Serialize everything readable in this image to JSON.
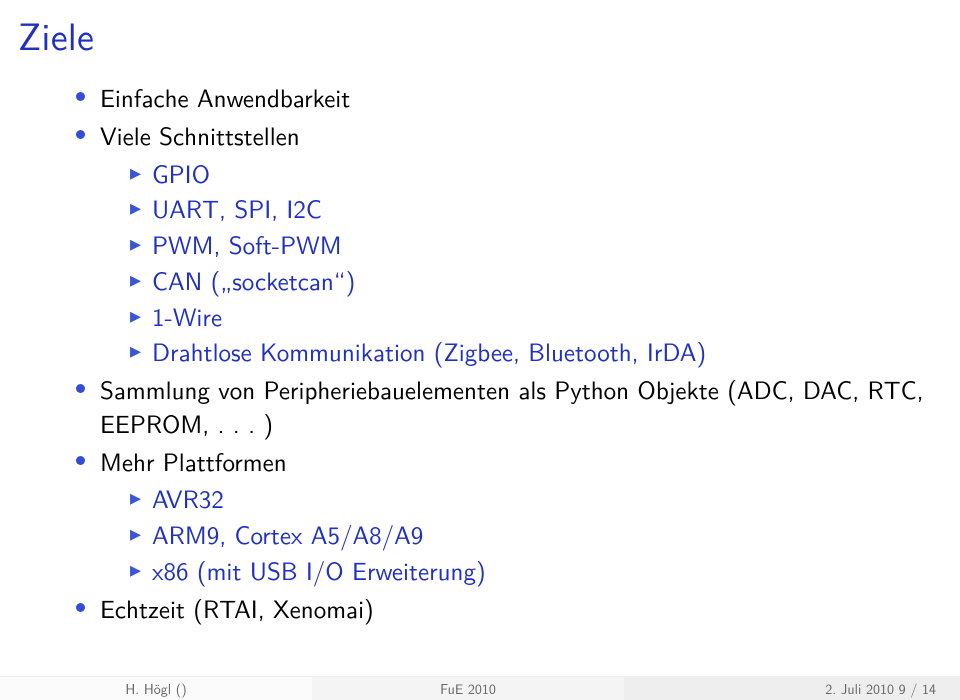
{
  "title": "Ziele",
  "bullets": {
    "b1": "Einfache Anwendbarkeit",
    "b2": "Viele Schnittstellen",
    "b2_sub": {
      "s1": "GPIO",
      "s2": "UART, SPI, I2C",
      "s3": "PWM, Soft-PWM",
      "s4": "CAN („socketcan“)",
      "s5": "1-Wire",
      "s6": "Drahtlose Kommunikation (Zigbee, Bluetooth, IrDA)"
    },
    "b3": "Sammlung von Peripheriebauelementen als Python Objekte (ADC, DAC, RTC, EEPROM, . . . )",
    "b4": "Mehr Plattformen",
    "b4_sub": {
      "s1": "AVR32",
      "s2": "ARM9, Cortex A5/A8/A9",
      "s3": "x86 (mit USB I/O Erweiterung)"
    },
    "b5": "Echtzeit (RTAI, Xenomai)"
  },
  "footer": {
    "left": "H. Högl ()",
    "mid": "FuE 2010",
    "right": "2. Juli 2010    9 / 14"
  }
}
